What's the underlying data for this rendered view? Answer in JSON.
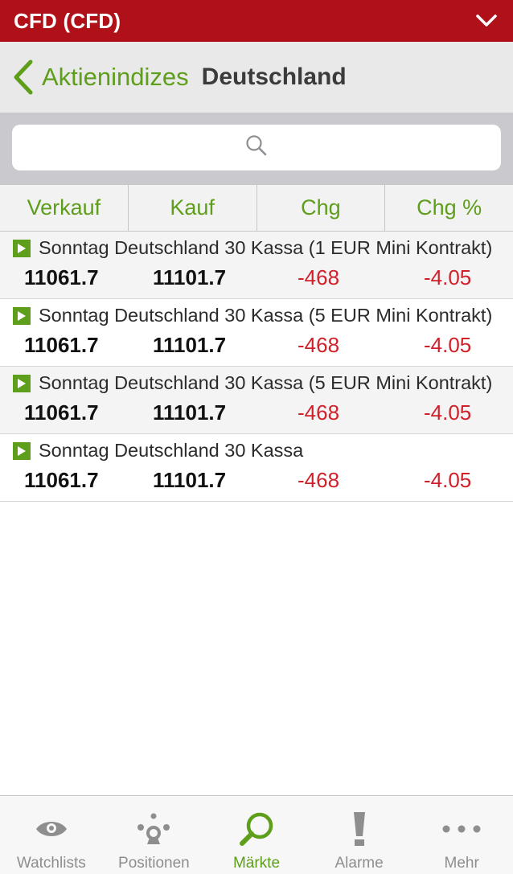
{
  "account_bar": {
    "title": "CFD (CFD)"
  },
  "nav": {
    "back_label": "Aktienindizes",
    "title": "Deutschland"
  },
  "search": {
    "placeholder": "",
    "value": ""
  },
  "columns": [
    "Verkauf",
    "Kauf",
    "Chg",
    "Chg %"
  ],
  "rows": [
    {
      "name": "Sonntag Deutschland 30 Kassa (1 EUR Mini Kontrakt)",
      "sell": "11061.7",
      "buy": "11101.7",
      "chg": "-468",
      "chg_pct": "-4.05"
    },
    {
      "name": "Sonntag Deutschland 30 Kassa (5 EUR Mini Kontrakt)",
      "sell": "11061.7",
      "buy": "11101.7",
      "chg": "-468",
      "chg_pct": "-4.05"
    },
    {
      "name": "Sonntag Deutschland 30 Kassa (5 EUR Mini Kontrakt)",
      "sell": "11061.7",
      "buy": "11101.7",
      "chg": "-468",
      "chg_pct": "-4.05"
    },
    {
      "name": "Sonntag Deutschland 30 Kassa",
      "sell": "11061.7",
      "buy": "11101.7",
      "chg": "-468",
      "chg_pct": "-4.05"
    }
  ],
  "tabs": [
    {
      "label": "Watchlists",
      "icon": "eye-icon",
      "active": false
    },
    {
      "label": "Positionen",
      "icon": "positions-icon",
      "active": false
    },
    {
      "label": "Märkte",
      "icon": "search-icon",
      "active": true
    },
    {
      "label": "Alarme",
      "icon": "exclamation-icon",
      "active": false
    },
    {
      "label": "Mehr",
      "icon": "more-icon",
      "active": false
    }
  ],
  "colors": {
    "brand_red": "#b01018",
    "accent_green": "#5d9e1a",
    "negative_red": "#d0202a"
  }
}
